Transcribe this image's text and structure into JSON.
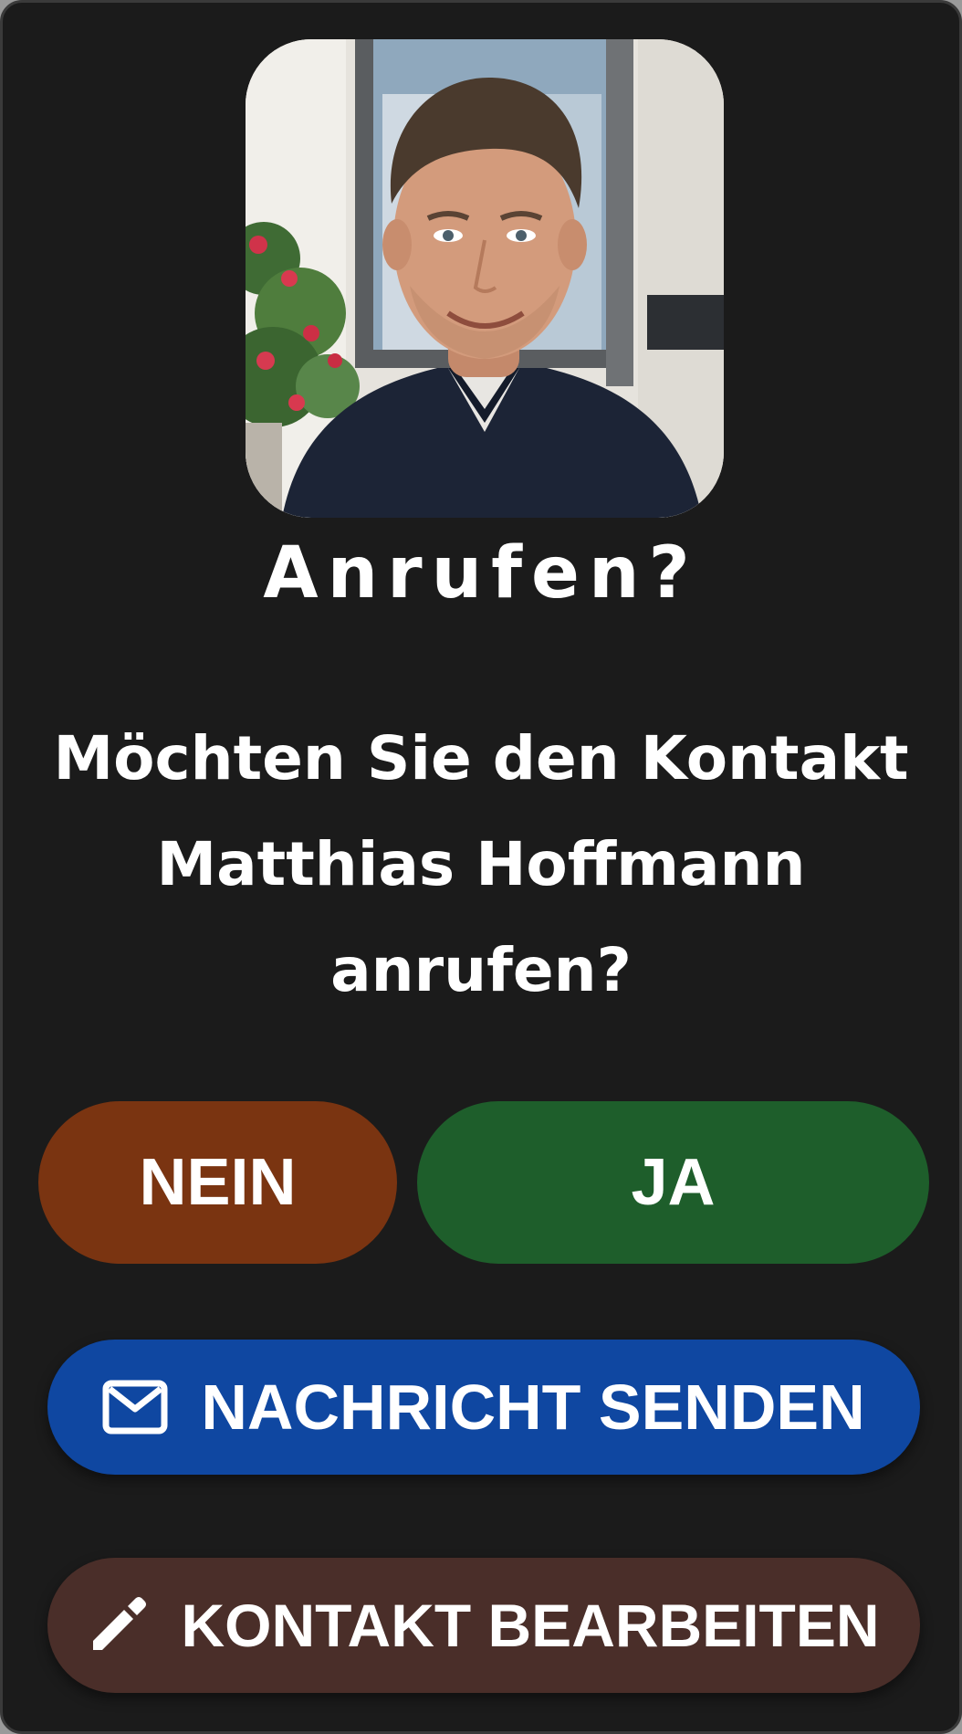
{
  "dialog": {
    "title": "Anrufen?",
    "message": "Möchten Sie den Kontakt Matthias Hoffmann anrufen?",
    "contact_name": "Matthias Hoffmann"
  },
  "buttons": {
    "no_label": "NEIN",
    "yes_label": "JA",
    "message_label": "NACHRICHT SENDEN",
    "edit_label": "KONTAKT BEARBEITEN"
  },
  "icons": {
    "message": "mail-icon",
    "edit": "pencil-icon"
  },
  "colors": {
    "background": "#1b1b1b",
    "no_button": "#7a3411",
    "yes_button": "#1e5e2b",
    "message_button": "#0f47a1",
    "edit_button": "#4a2e29",
    "text": "#ffffff"
  }
}
